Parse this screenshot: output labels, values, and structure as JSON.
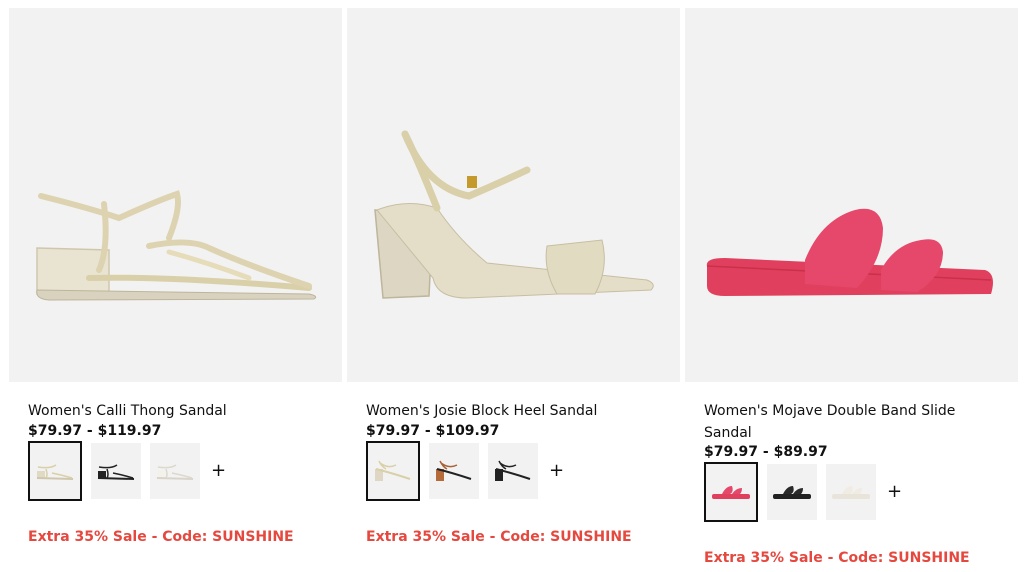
{
  "colors": {
    "promo": "#e5483f",
    "image_bg": "#f2f2f2",
    "text": "#111111"
  },
  "products": [
    {
      "title": "Women's Calli Thong Sandal",
      "price": "$79.97 - $119.97",
      "promo": "Extra 35% Sale - Code: SUNSHINE",
      "more_label": "+",
      "swatches": [
        "gold",
        "black",
        "white"
      ],
      "selected_swatch": 0
    },
    {
      "title": "Women's Josie Block Heel Sandal",
      "price": "$79.97 - $109.97",
      "promo": "Extra 35% Sale - Code: SUNSHINE",
      "more_label": "+",
      "swatches": [
        "gold",
        "tan",
        "black"
      ],
      "selected_swatch": 0
    },
    {
      "title": "Women's Mojave Double Band Slide Sandal",
      "price": "$79.97 - $89.97",
      "promo": "Extra 35% Sale - Code: SUNSHINE",
      "more_label": "+",
      "swatches": [
        "pink",
        "black",
        "white"
      ],
      "selected_swatch": 0
    }
  ]
}
